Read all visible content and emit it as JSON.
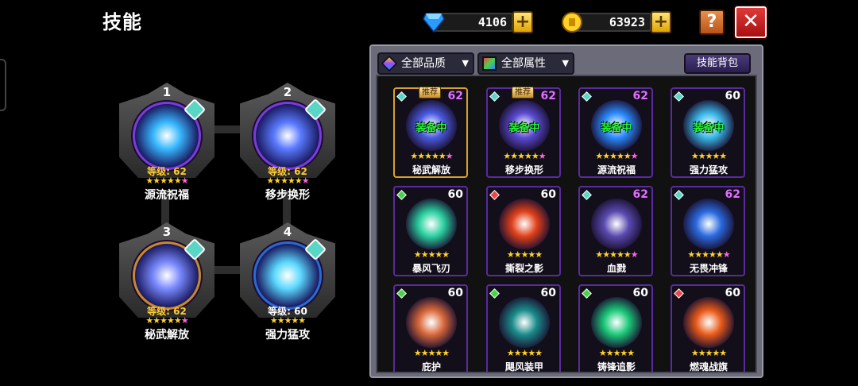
{
  "header": {
    "title": "技能",
    "diamonds": "4106",
    "gold": "63923",
    "plus": "+",
    "help": "?",
    "close": "✕"
  },
  "slots": [
    {
      "num": "1",
      "level": "等级: 62",
      "name": "源流祝福",
      "stars": "★★★★★",
      "pink_star": "★",
      "ring": "purple",
      "art": "#38b8ff"
    },
    {
      "num": "2",
      "level": "等级: 62",
      "name": "移步换形",
      "stars": "★★★★★",
      "pink_star": "★",
      "ring": "purple",
      "art": "#5a7aff"
    },
    {
      "num": "3",
      "level": "等级: 62",
      "name": "秘武解放",
      "stars": "★★★★★",
      "pink_star": "★",
      "ring": "gold",
      "art": "#7a8aff"
    },
    {
      "num": "4",
      "level": "等级: 60",
      "name": "强力猛攻",
      "stars": "★★★★★",
      "pink_star": "",
      "ring": "blue",
      "art": "#5ad8ff"
    }
  ],
  "filters": {
    "quality": "全部品质",
    "attribute": "全部属性",
    "bag": "技能背包"
  },
  "cards": [
    {
      "name": "秘武解放",
      "level": "62",
      "purple": true,
      "tag": "推荐",
      "equipped": "装备中",
      "stars": "★★★★★",
      "pink_star": "★",
      "gold": true,
      "gem": "#5ad6c6",
      "art": "#4a5ae0"
    },
    {
      "name": "移步换形",
      "level": "62",
      "purple": true,
      "tag": "推荐",
      "equipped": "装备中",
      "stars": "★★★★★",
      "pink_star": "★",
      "gold": false,
      "gem": "#5ad6c6",
      "art": "#5a4ad0"
    },
    {
      "name": "源流祝福",
      "level": "62",
      "purple": true,
      "tag": "",
      "equipped": "装备中",
      "stars": "★★★★★",
      "pink_star": "★",
      "gold": false,
      "gem": "#5ad6c6",
      "art": "#2a8aff"
    },
    {
      "name": "强力猛攻",
      "level": "60",
      "purple": false,
      "tag": "",
      "equipped": "装备中",
      "stars": "★★★★★",
      "pink_star": "",
      "gold": false,
      "gem": "#5ad6c6",
      "art": "#3ab8e8"
    },
    {
      "name": "暴风飞刃",
      "level": "60",
      "purple": false,
      "tag": "",
      "equipped": "",
      "stars": "★★★★★",
      "pink_star": "",
      "gold": false,
      "gem": "#4ad04a",
      "art": "#2ad0a0"
    },
    {
      "name": "撕裂之影",
      "level": "60",
      "purple": false,
      "tag": "",
      "equipped": "",
      "stars": "★★★★★",
      "pink_star": "",
      "gold": false,
      "gem": "#e84a4a",
      "art": "#e0401a"
    },
    {
      "name": "血戮",
      "level": "62",
      "purple": true,
      "tag": "",
      "equipped": "",
      "stars": "★★★★★",
      "pink_star": "★",
      "gold": false,
      "gem": "#5ad6c6",
      "art": "#5a4ab0"
    },
    {
      "name": "无畏冲锋",
      "level": "62",
      "purple": true,
      "tag": "",
      "equipped": "",
      "stars": "★★★★★",
      "pink_star": "★",
      "gold": false,
      "gem": "#5ad6c6",
      "art": "#2a6ae0"
    },
    {
      "name": "庇护",
      "level": "60",
      "purple": false,
      "tag": "",
      "equipped": "",
      "stars": "★★★★★",
      "pink_star": "",
      "gold": false,
      "gem": "#4ad04a",
      "art": "#d8683a"
    },
    {
      "name": "飓风装甲",
      "level": "60",
      "purple": false,
      "tag": "",
      "equipped": "",
      "stars": "★★★★★",
      "pink_star": "",
      "gold": false,
      "gem": "#4ad04a",
      "art": "#1a8a8a"
    },
    {
      "name": "铸锋追影",
      "level": "60",
      "purple": false,
      "tag": "",
      "equipped": "",
      "stars": "★★★★★",
      "pink_star": "",
      "gold": false,
      "gem": "#4ad04a",
      "art": "#1ac878"
    },
    {
      "name": "燃魂战旗",
      "level": "60",
      "purple": false,
      "tag": "",
      "equipped": "",
      "stars": "★★★★★",
      "pink_star": "",
      "gold": false,
      "gem": "#e84a4a",
      "art": "#e85a1a"
    }
  ]
}
